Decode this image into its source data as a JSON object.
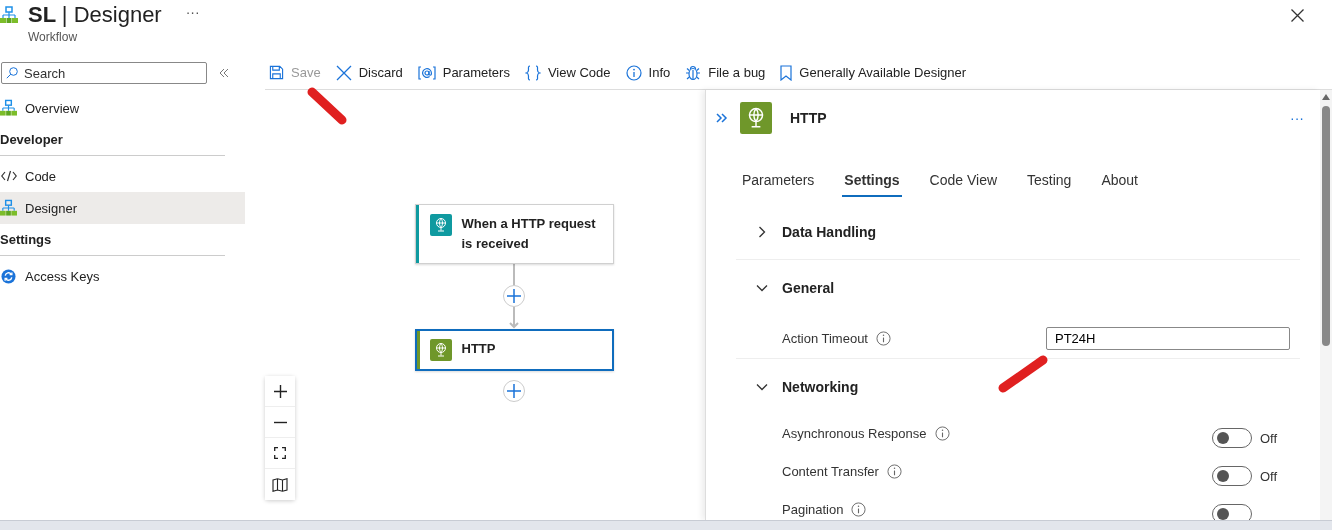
{
  "header": {
    "title": "SL | Designer",
    "subtitle": "Workflow",
    "more": "···"
  },
  "sidebar": {
    "search": {
      "placeholder": "Search"
    },
    "items": [
      {
        "kind": "item",
        "label": "Overview",
        "selected": false
      },
      {
        "kind": "heading",
        "label": "Developer"
      },
      {
        "kind": "item",
        "label": "Code",
        "selected": false
      },
      {
        "kind": "item",
        "label": "Designer",
        "selected": true
      },
      {
        "kind": "heading",
        "label": "Settings"
      },
      {
        "kind": "item",
        "label": "Access Keys",
        "selected": false
      }
    ]
  },
  "toolbar": [
    {
      "label": "Save",
      "disabled": true
    },
    {
      "label": "Discard",
      "disabled": false
    },
    {
      "label": "Parameters",
      "disabled": false
    },
    {
      "label": "View Code",
      "disabled": false
    },
    {
      "label": "Info",
      "disabled": false
    },
    {
      "label": "File a bug",
      "disabled": false
    },
    {
      "label": "Generally Available Designer",
      "disabled": false
    }
  ],
  "flow": {
    "nodes": [
      {
        "kind": "trigger",
        "title": "When a HTTP request is received",
        "selected": false
      },
      {
        "kind": "action",
        "title": "HTTP",
        "selected": true
      }
    ]
  },
  "panel": {
    "title": "HTTP",
    "more": "···",
    "tabs": [
      {
        "label": "Parameters",
        "selected": false
      },
      {
        "label": "Settings",
        "selected": true
      },
      {
        "label": "Code View",
        "selected": false
      },
      {
        "label": "Testing",
        "selected": false
      },
      {
        "label": "About",
        "selected": false
      }
    ],
    "sections": [
      {
        "title": "Data Handling",
        "expanded": false
      },
      {
        "title": "General",
        "expanded": true,
        "rows": [
          {
            "kind": "text",
            "label": "Action Timeout",
            "value": "PT24H"
          }
        ]
      },
      {
        "title": "Networking",
        "expanded": true,
        "rows": [
          {
            "kind": "toggle",
            "label": "Asynchronous Response",
            "on": false,
            "state": "Off"
          },
          {
            "kind": "toggle",
            "label": "Content Transfer",
            "on": false,
            "state": "Off"
          },
          {
            "kind": "toggle",
            "label": "Pagination",
            "on": false
          }
        ]
      }
    ]
  }
}
